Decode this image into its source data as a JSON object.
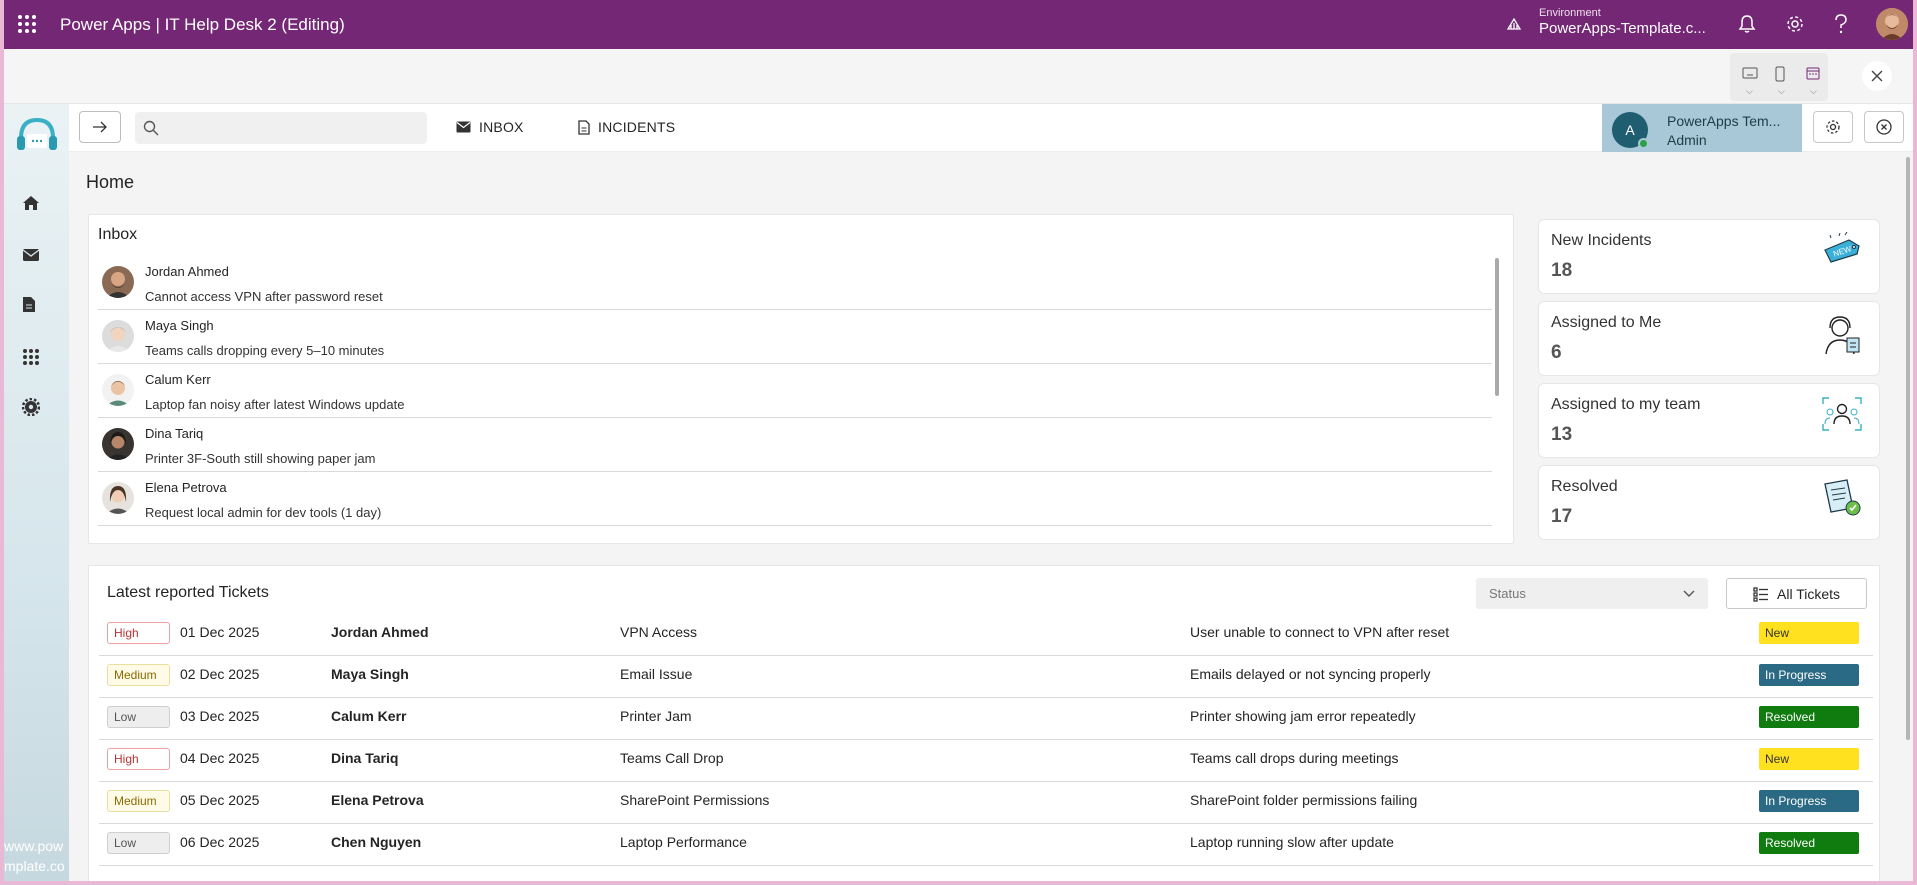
{
  "topbar": {
    "app_title": "Power Apps  |  IT Help Desk 2 (Editing)",
    "environment_label": "Environment",
    "environment_name": "PowerApps-Template.c...",
    "icons": [
      "waffle-icon",
      "environment-icon",
      "bell-icon",
      "gear-icon",
      "help-icon",
      "avatar"
    ]
  },
  "header": {
    "search_placeholder": "",
    "tabs": [
      {
        "label": "INBOX",
        "icon": "mail-icon"
      },
      {
        "label": "INCIDENTS",
        "icon": "document-icon"
      }
    ],
    "user": {
      "initial": "A",
      "name": "PowerApps Tem...",
      "role": "Admin"
    }
  },
  "sidebar": {
    "items": [
      "home-icon",
      "mail-icon",
      "document-icon",
      "apps-icon",
      "settings-icon"
    ],
    "watermark": [
      "www.pow",
      "mplate.co"
    ]
  },
  "page": {
    "title": "Home"
  },
  "inbox": {
    "title": "Inbox",
    "items": [
      {
        "name": "Jordan Ahmed",
        "subject": "Cannot access VPN after password reset"
      },
      {
        "name": "Maya Singh",
        "subject": "Teams calls dropping every 5–10 minutes"
      },
      {
        "name": "Calum Kerr",
        "subject": "Laptop fan noisy after latest Windows update"
      },
      {
        "name": "Dina Tariq",
        "subject": "Printer 3F-South still showing paper jam"
      },
      {
        "name": "Elena Petrova",
        "subject": "Request local admin for dev tools (1 day)"
      }
    ]
  },
  "stats": [
    {
      "label": "New Incidents",
      "value": "18",
      "icon": "new-tag-icon"
    },
    {
      "label": "Assigned to Me",
      "value": "6",
      "icon": "agent-icon"
    },
    {
      "label": "Assigned to my team",
      "value": "13",
      "icon": "team-icon"
    },
    {
      "label": "Resolved",
      "value": "17",
      "icon": "resolved-doc-icon"
    }
  ],
  "tickets": {
    "title": "Latest reported Tickets",
    "status_placeholder": "Status",
    "all_button": "All Tickets",
    "rows": [
      {
        "priority": "High",
        "date": "01 Dec 2025",
        "name": "Jordan Ahmed",
        "category": "VPN Access",
        "description": "User unable to connect to VPN after reset",
        "status": "New"
      },
      {
        "priority": "Medium",
        "date": "02 Dec 2025",
        "name": "Maya Singh",
        "category": "Email Issue",
        "description": "Emails delayed or not syncing properly",
        "status": "In Progress"
      },
      {
        "priority": "Low",
        "date": "03 Dec 2025",
        "name": "Calum Kerr",
        "category": "Printer Jam",
        "description": "Printer showing jam error repeatedly",
        "status": "Resolved"
      },
      {
        "priority": "High",
        "date": "04 Dec 2025",
        "name": "Dina Tariq",
        "category": "Teams Call Drop",
        "description": "Teams call drops during meetings",
        "status": "New"
      },
      {
        "priority": "Medium",
        "date": "05 Dec 2025",
        "name": "Elena Petrova",
        "category": "SharePoint Permissions",
        "description": "SharePoint folder permissions failing",
        "status": "In Progress"
      },
      {
        "priority": "Low",
        "date": "06 Dec 2025",
        "name": "Chen Nguyen",
        "category": "Laptop Performance",
        "description": "Laptop running slow after update",
        "status": "Resolved"
      }
    ]
  },
  "colors": {
    "brand": "#742774",
    "high": "#cc3333",
    "new": "#ffe11f",
    "in_progress": "#2b6a84",
    "resolved": "#107c10"
  }
}
